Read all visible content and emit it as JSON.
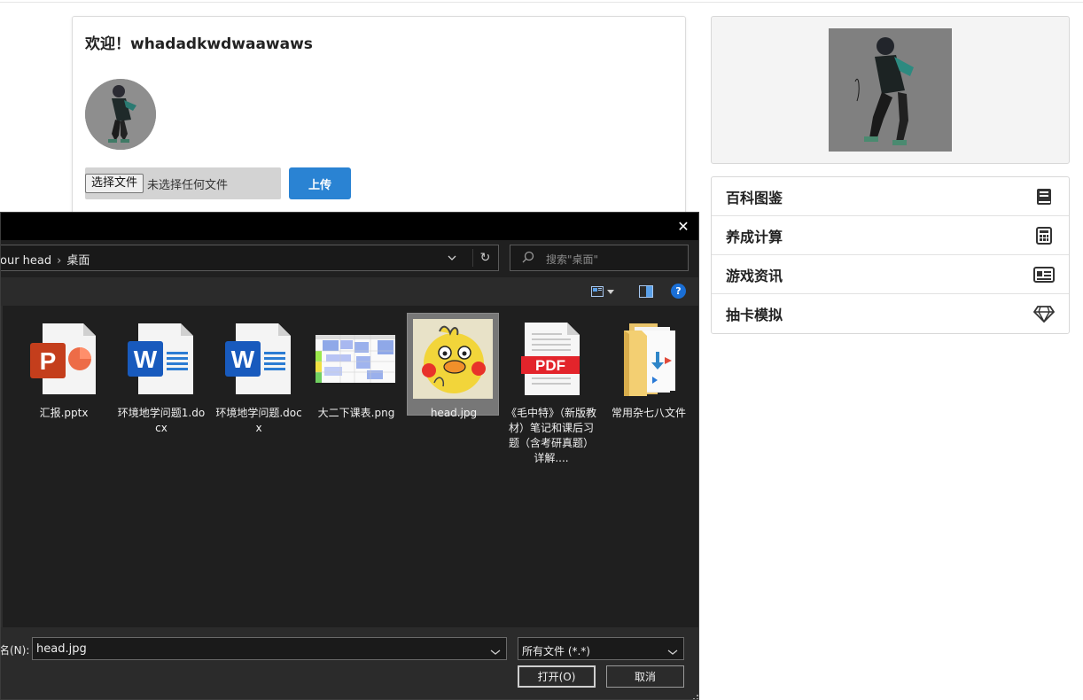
{
  "page": {
    "welcome_text": "欢迎！whadadkwdwaawaws",
    "choose_file_label": "选择文件",
    "no_file_text": "未选择任何文件",
    "upload_label": "上传"
  },
  "side_menu": {
    "items": [
      {
        "label": "百科图鉴",
        "icon": "book-icon"
      },
      {
        "label": "养成计算",
        "icon": "calculator-icon"
      },
      {
        "label": "游戏资讯",
        "icon": "newspaper-icon"
      },
      {
        "label": "抽卡模拟",
        "icon": "diamond-icon"
      }
    ]
  },
  "dialog": {
    "close_glyph": "✕",
    "breadcrumb": {
      "parent": "our head",
      "separator": "›",
      "current": "桌面"
    },
    "refresh_glyph": "↻",
    "search_placeholder": "搜索\"桌面\"",
    "help_glyph": "?",
    "files": [
      {
        "name": "汇报.pptx",
        "icon": "powerpoint-file-icon"
      },
      {
        "name": "环境地学问题1.docx",
        "icon": "word-file-icon"
      },
      {
        "name": "环境地学问题.docx",
        "icon": "word-file-icon"
      },
      {
        "name": "大二下课表.png",
        "icon": "spreadsheet-image-icon"
      },
      {
        "name": "head.jpg",
        "icon": "image-thumbnail-icon",
        "selected": true
      },
      {
        "name": "《毛中特》（新版教材）笔记和课后习题（含考研真题）详解....",
        "icon": "pdf-file-icon"
      },
      {
        "name": "常用杂七八文件",
        "icon": "folder-icon"
      }
    ],
    "filename_label": "名(N):",
    "filename_value": "head.jpg",
    "filetype_value": "所有文件 (*.*)",
    "open_label": "打开(O)",
    "cancel_label": "取消",
    "pdf_badge": "PDF",
    "ppt_letter": "P",
    "word_letter": "W"
  },
  "colors": {
    "accent_blue": "#2a83d3",
    "dialog_bg": "#202020",
    "pdf_red": "#e3242b",
    "word_blue": "#185abd",
    "ppt_orange": "#c43e1c"
  }
}
